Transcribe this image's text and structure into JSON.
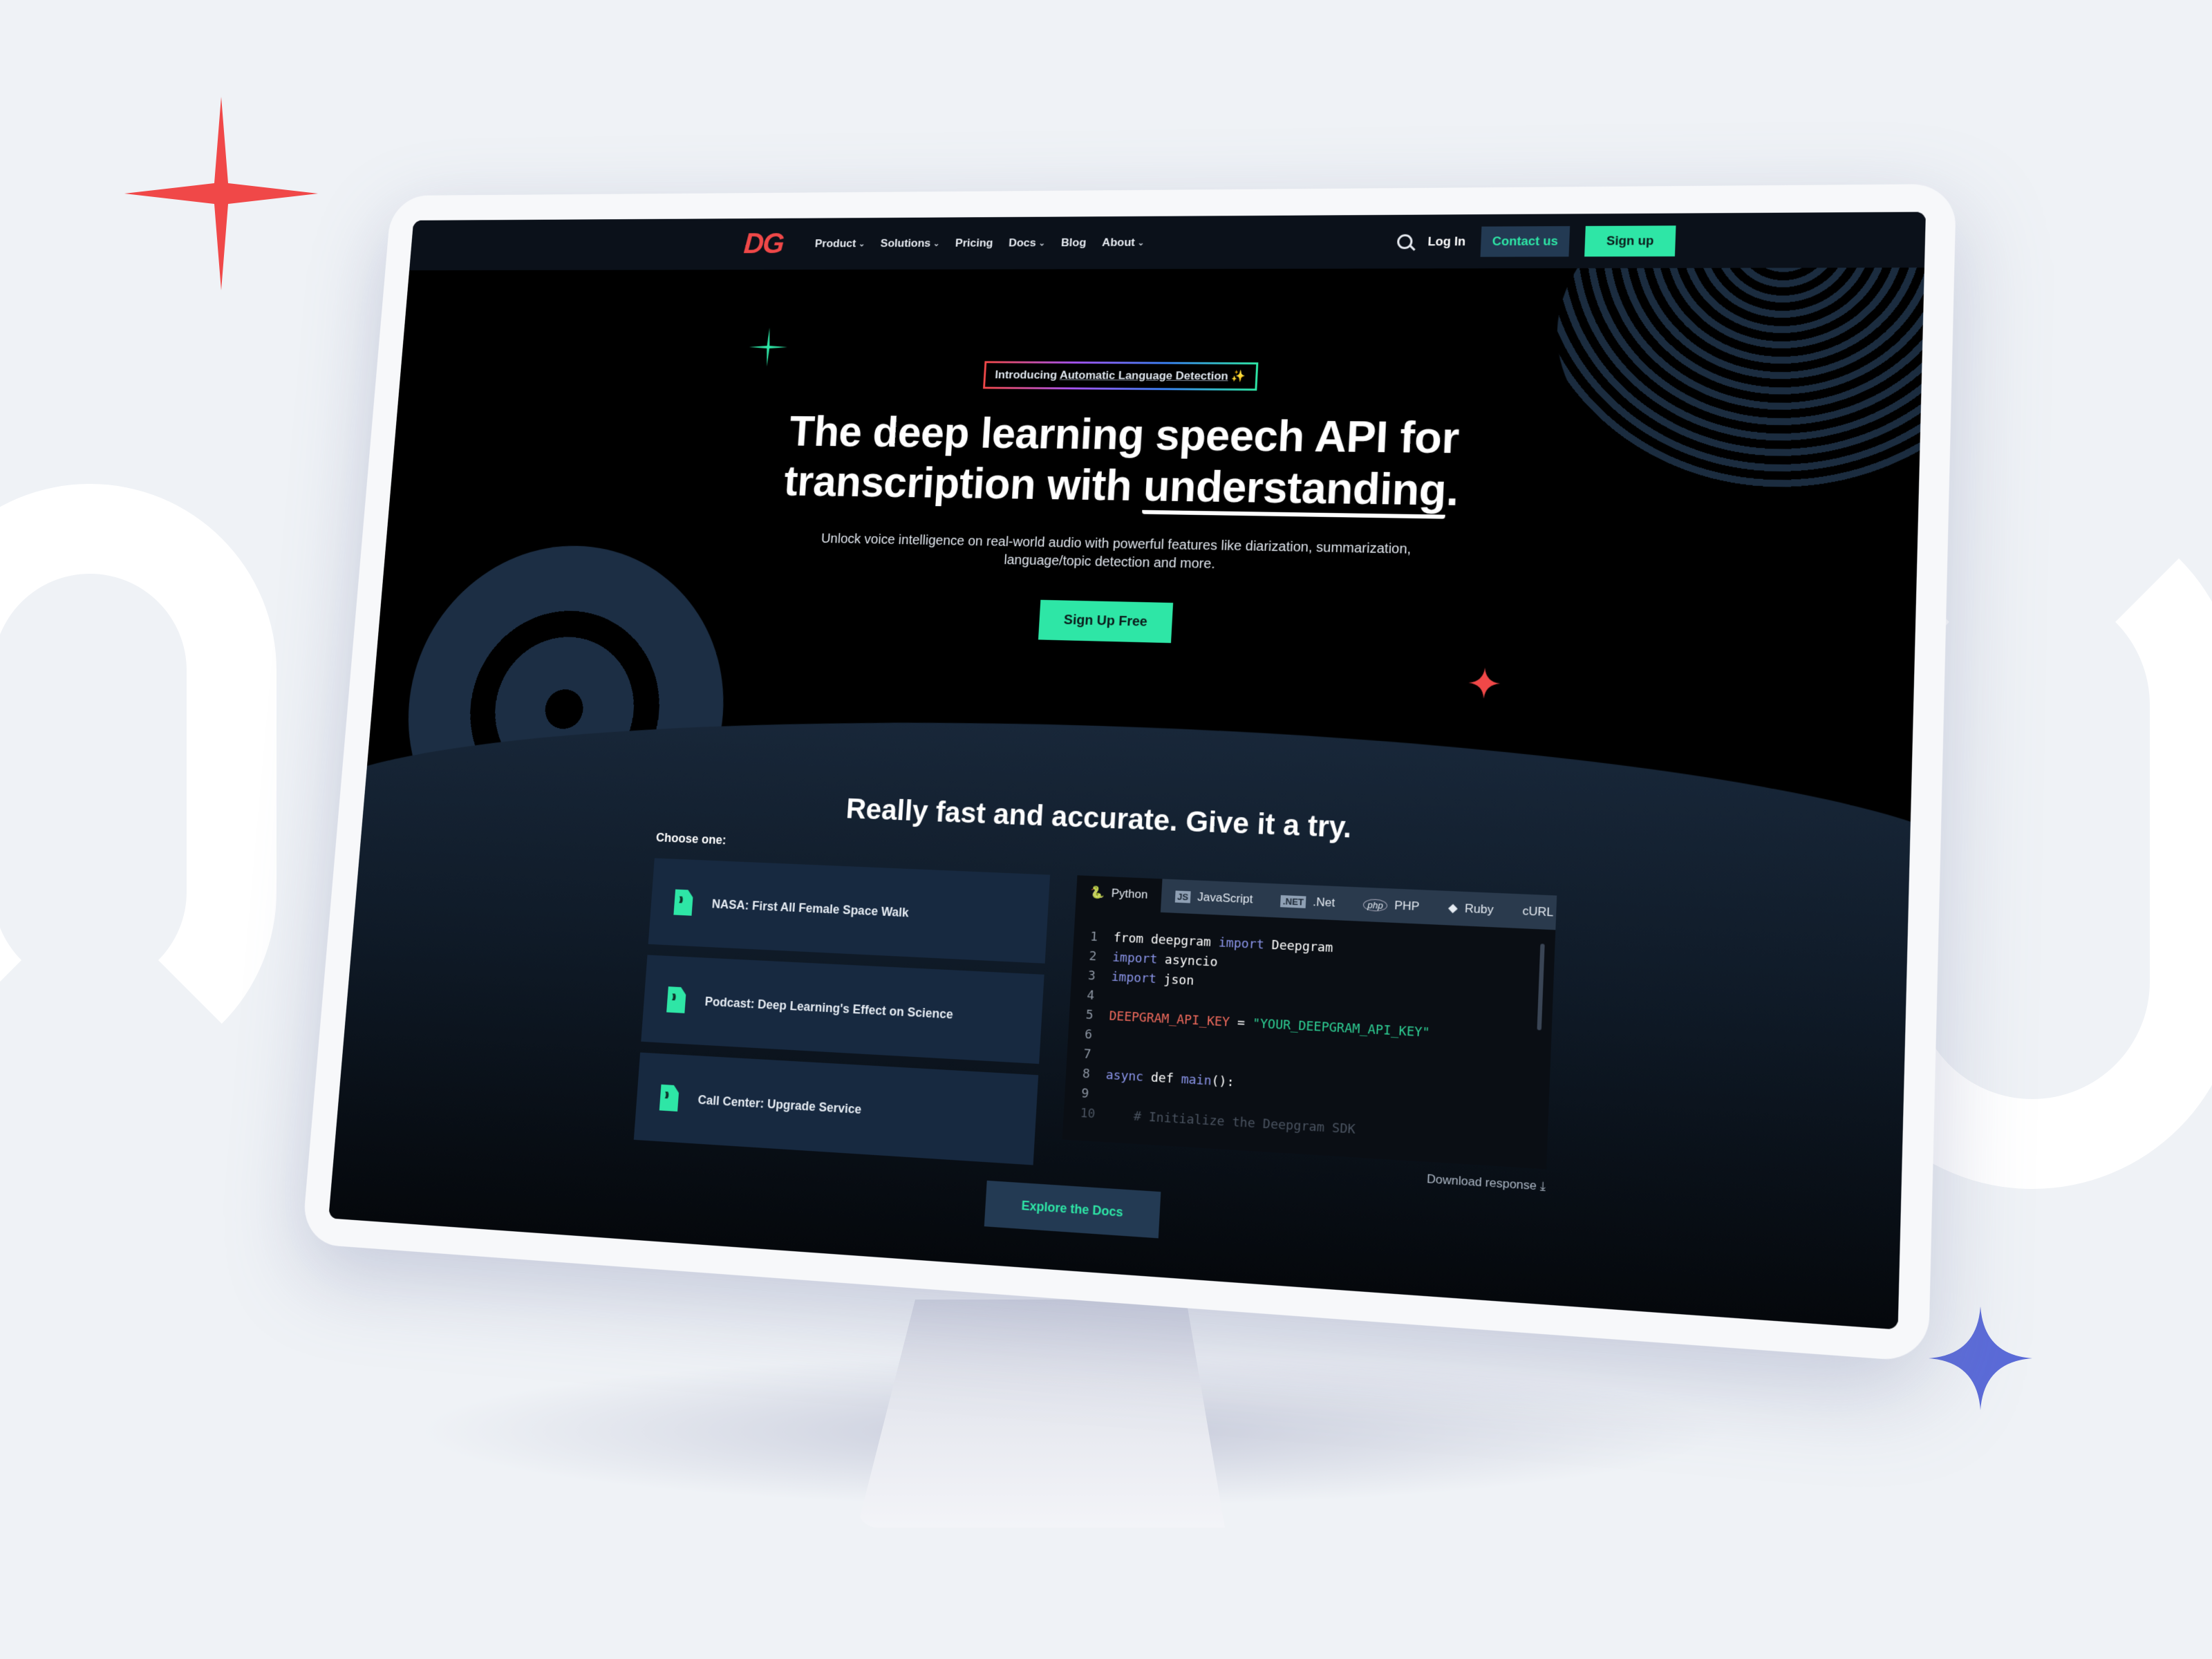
{
  "nav": {
    "logo": "DG",
    "links": [
      {
        "label": "Product",
        "dropdown": true
      },
      {
        "label": "Solutions",
        "dropdown": true
      },
      {
        "label": "Pricing",
        "dropdown": false
      },
      {
        "label": "Docs",
        "dropdown": true
      },
      {
        "label": "Blog",
        "dropdown": false
      },
      {
        "label": "About",
        "dropdown": true
      }
    ],
    "login": "Log In",
    "contact": "Contact us",
    "signup": "Sign up",
    "search_icon": "search-icon"
  },
  "hero": {
    "badge_prefix": "Introducing",
    "badge_link": "Automatic Language Detection",
    "badge_emoji": "✨",
    "headline_line1": "The deep learning speech API for",
    "headline_line2a": "transcription with ",
    "headline_line2b": "understanding",
    "headline_line2c": ".",
    "subtitle": "Unlock voice intelligence on real-world audio with powerful features like diarization, summarization, language/topic detection and more.",
    "cta": "Sign Up Free"
  },
  "demo": {
    "title": "Really fast and accurate. Give it a try.",
    "choose_label": "Choose one:",
    "samples": [
      "NASA: First All Female Space Walk",
      "Podcast: Deep Learning's Effect on Science",
      "Call Center: Upgrade Service"
    ],
    "tabs": [
      {
        "label": "Python",
        "icon": "🐍",
        "active": true
      },
      {
        "label": "JavaScript",
        "icon": "JS",
        "active": false
      },
      {
        "label": ".Net",
        "icon": ".NET",
        "active": false
      },
      {
        "label": "PHP",
        "icon": "php",
        "active": false
      },
      {
        "label": "Ruby",
        "icon": "◆",
        "active": false
      },
      {
        "label": "cURL",
        "icon": "",
        "active": false
      }
    ],
    "code": {
      "l1a": "from deepgram ",
      "l1b": "import",
      "l1c": " Deepgram",
      "l2a": "import",
      "l2b": " asyncio",
      "l3a": "import",
      "l3b": " json",
      "l5a": "DEEPGRAM_API_KEY",
      "l5b": " = ",
      "l5c": "\"YOUR_DEEPGRAM_API_KEY\"",
      "l8a": "async",
      "l8b": " def ",
      "l8c": "main",
      "l8d": "():",
      "l10": "    # Initialize the Deepgram SDK"
    },
    "download": "Download response ⤓",
    "docs_button": "Explore the Docs"
  },
  "colors": {
    "accent_green": "#2ee6a6",
    "brand_red": "#f04848",
    "navy": "#172940"
  }
}
